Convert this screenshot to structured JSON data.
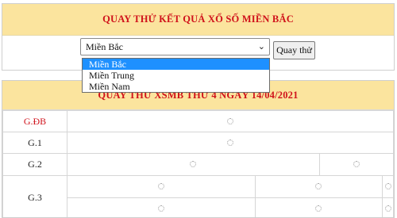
{
  "top_panel": {
    "title": "QUAY THỬ KẾT QUẢ XỔ SỐ MIỀN BẮC",
    "select_value": "Miền Bắc",
    "button_label": "Quay thử",
    "options": [
      "Miền Bắc",
      "Miền Trung",
      "Miền Nam"
    ]
  },
  "result_panel": {
    "title": "QUAY THỬ XSMB THỨ 4 NGÀY 14/04/2021",
    "prizes": [
      "G.ĐB",
      "G.1",
      "G.2",
      "G.3"
    ]
  },
  "colors": {
    "header_bg": "#fbe49e",
    "title_red": "#d0121b",
    "selected_option": "#1e90ff"
  },
  "icons": {
    "loading": "loading-spinner-icon",
    "dropdown": "chevron-down-icon"
  }
}
